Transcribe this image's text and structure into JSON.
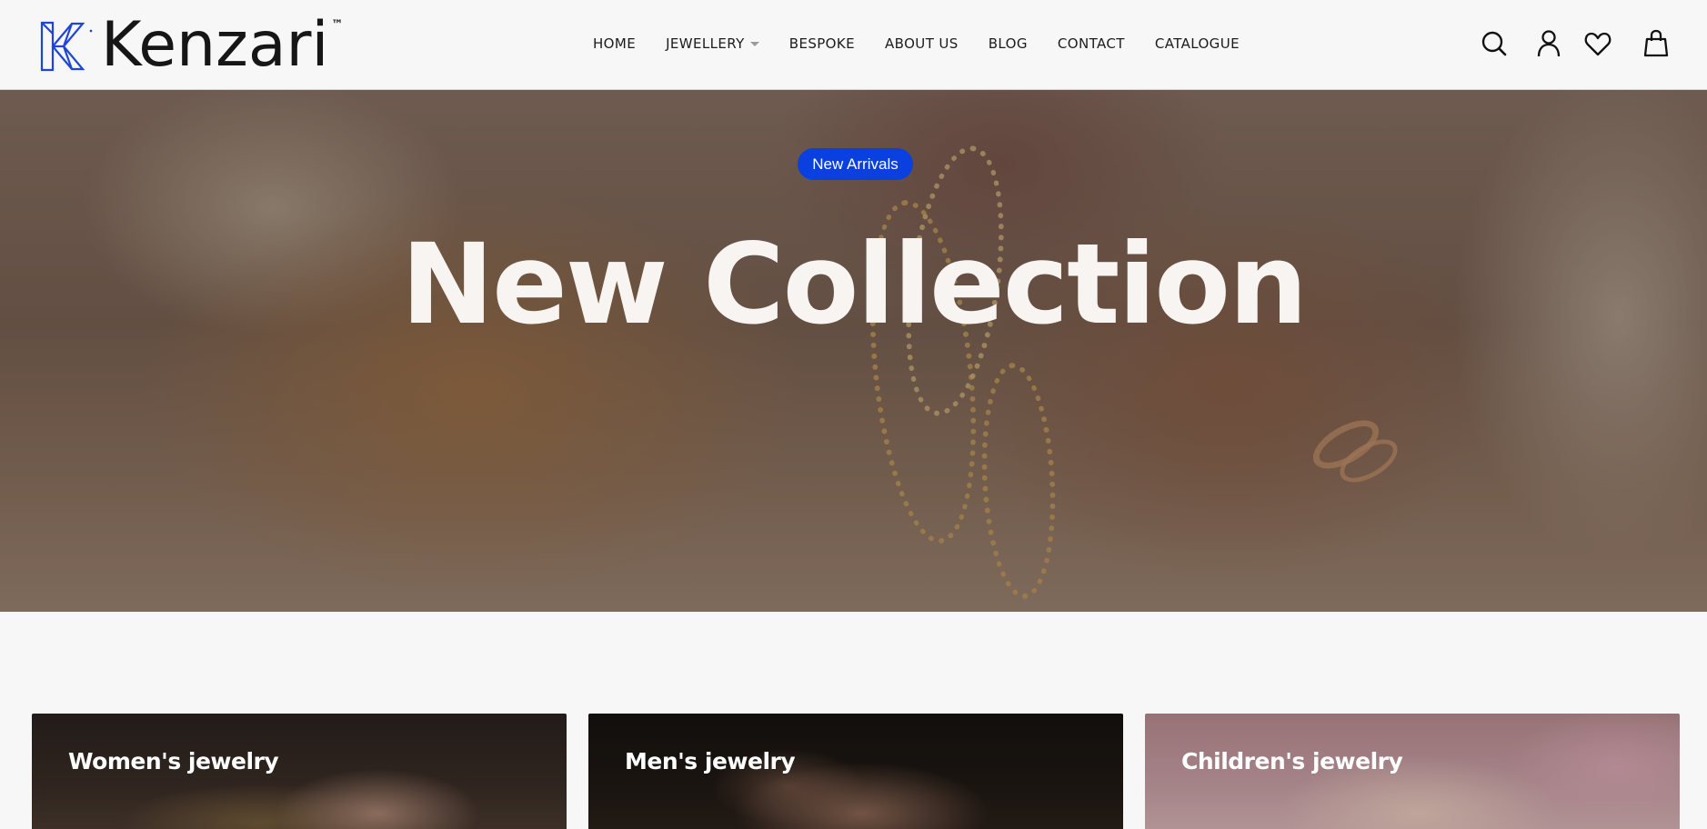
{
  "brand": {
    "name": "Kenzari",
    "trademark": "™",
    "accent_color": "#0a3fe0"
  },
  "nav": {
    "items": [
      {
        "label": "HOME"
      },
      {
        "label": "JEWELLERY",
        "has_dropdown": true
      },
      {
        "label": "BESPOKE"
      },
      {
        "label": "ABOUT US"
      },
      {
        "label": "BLOG"
      },
      {
        "label": "CONTACT"
      },
      {
        "label": "CATALOGUE"
      }
    ]
  },
  "header_icons": [
    "search-icon",
    "account-icon",
    "wishlist-heart-icon",
    "cart-bag-icon"
  ],
  "hero": {
    "badge": "New Arrivals",
    "title": "New Collection"
  },
  "categories": [
    {
      "title": "Women's jewelry"
    },
    {
      "title": "Men's jewelry"
    },
    {
      "title": "Children's jewelry"
    }
  ]
}
